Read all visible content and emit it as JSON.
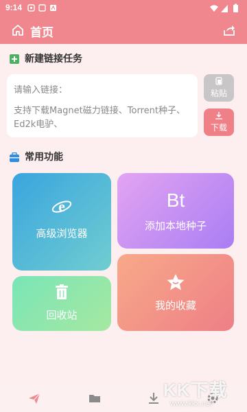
{
  "status_bar": {
    "time": "9:14"
  },
  "title_bar": {
    "title": "首页"
  },
  "new_task": {
    "heading": "新建链接任务",
    "placeholder": "请输入链接：",
    "hint": "支持下载Magnet磁力链接、Torrent种子、Ed2k电驴、"
  },
  "actions": {
    "paste": "粘贴",
    "download": "下载"
  },
  "features": {
    "heading": "常用功能",
    "browser": "高级浏览器",
    "bt_glyph": "Bt",
    "add_torrent": "添加本地种子",
    "recycle": "回收站",
    "favorites": "我的收藏"
  },
  "watermark": {
    "text": "KK下载",
    "url": "www.kkx.net"
  },
  "colors": {
    "primary": "#f1878e",
    "background": "#fdeff0"
  }
}
